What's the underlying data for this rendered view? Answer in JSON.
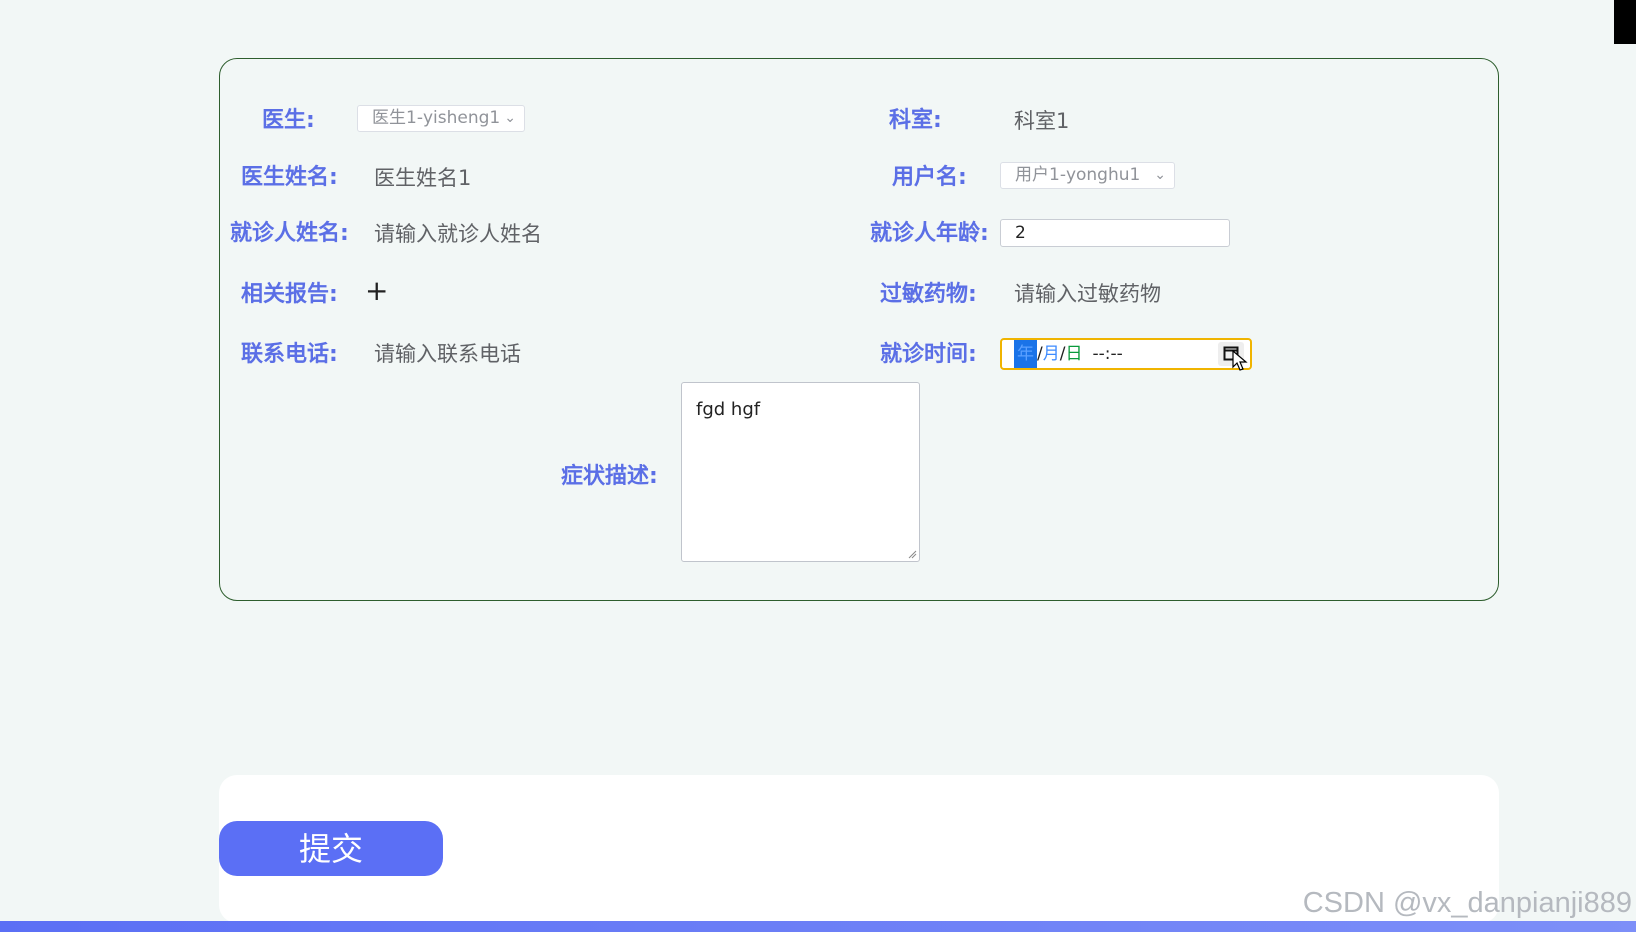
{
  "form": {
    "doctor": {
      "label": "医生:",
      "selected": "医生1-yisheng1"
    },
    "department": {
      "label": "科室:",
      "value": "科室1"
    },
    "doctor_name": {
      "label": "医生姓名:",
      "value": "医生姓名1"
    },
    "username": {
      "label": "用户名:",
      "selected": "用户1-yonghu1"
    },
    "patient_name": {
      "label": "就诊人姓名:",
      "placeholder": "请输入就诊人姓名"
    },
    "patient_age": {
      "label": "就诊人年龄:",
      "value": "2"
    },
    "report": {
      "label": "相关报告:",
      "upload_glyph": "+"
    },
    "allergy": {
      "label": "过敏药物:",
      "placeholder": "请输入过敏药物"
    },
    "phone": {
      "label": "联系电话:",
      "placeholder": "请输入联系电话"
    },
    "visit_time": {
      "label": "就诊时间:",
      "year": "年",
      "sep1": "/",
      "month": "月",
      "sep2": "/",
      "day": "日",
      "time": "--:--"
    },
    "symptoms": {
      "label": "症状描述:",
      "value": "fgd hgf"
    }
  },
  "submit": {
    "label": "提交"
  },
  "watermark": "CSDN @vx_danpianji889",
  "colors": {
    "label": "#5b6fe6",
    "button": "#5b6ff5",
    "focus_border": "#f0b400",
    "card_border": "#2e5e2e"
  }
}
